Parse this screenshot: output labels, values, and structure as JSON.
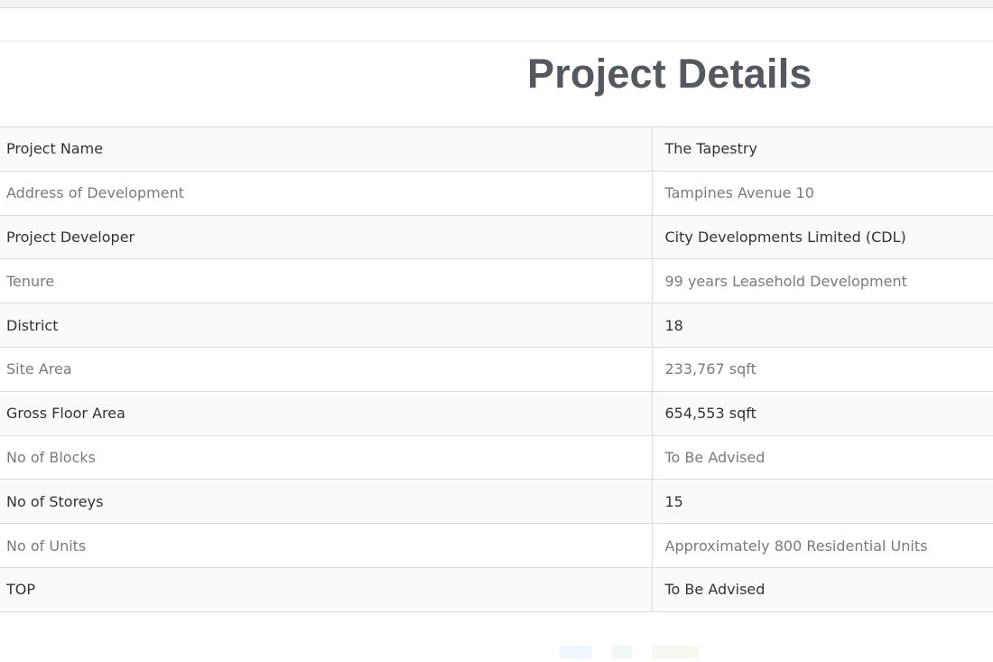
{
  "page": {
    "title": "Project Details"
  },
  "details": [
    {
      "label": "Project Name",
      "value": "The Tapestry"
    },
    {
      "label": "Address of Development",
      "value": "Tampines Avenue 10"
    },
    {
      "label": "Project Developer",
      "value": "City Developments Limited (CDL)"
    },
    {
      "label": "Tenure",
      "value": "99 years Leasehold Development"
    },
    {
      "label": "District",
      "value": "18"
    },
    {
      "label": "Site Area",
      "value": "233,767 sqft"
    },
    {
      "label": "Gross Floor Area",
      "value": "654,553 sqft"
    },
    {
      "label": "No of Blocks",
      "value": "To Be Advised"
    },
    {
      "label": "No of Storeys",
      "value": "15"
    },
    {
      "label": "No of Units",
      "value": "Approximately 800 Residential Units"
    },
    {
      "label": "TOP",
      "value": "To Be Advised"
    }
  ],
  "colors": {
    "title": "#54595f",
    "row_odd_bg": "#fafafa",
    "row_even_bg": "#ffffff",
    "border": "#dcdcdc"
  }
}
